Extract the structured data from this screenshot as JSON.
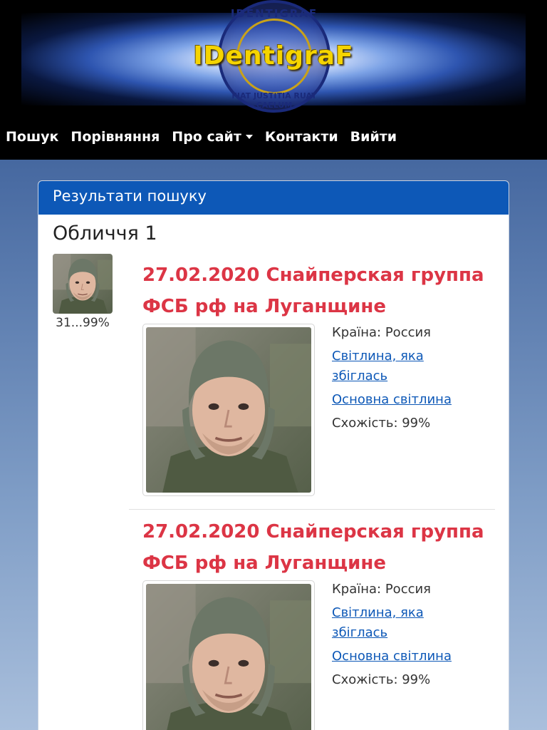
{
  "site": {
    "logo_text": "IDentigraF",
    "emblem_top": "IDENTIGRAF",
    "emblem_bottom": "FIAT JUSTITIA RUAT CAELUM"
  },
  "nav": {
    "items": [
      {
        "label": "Пошук"
      },
      {
        "label": "Порівняння"
      },
      {
        "label": "Про сайт",
        "dropdown": true
      },
      {
        "label": "Контакти"
      },
      {
        "label": "Вийти"
      }
    ]
  },
  "card": {
    "header": "Результати пошуку",
    "faces_title": "Обличчя 1",
    "thumb_caption": "31...99%"
  },
  "results": [
    {
      "title": "27.02.2020 Снайперская группа ФСБ рф на Луганщине",
      "country": "Країна: Россия",
      "matched_photo_link": "Світлина, яка збіглась",
      "main_photo_link": "Основна світлина",
      "similarity": "Схожість: 99%"
    },
    {
      "title": "27.02.2020 Снайперская группа ФСБ рф на Луганщине",
      "country": "Країна: Россия",
      "matched_photo_link": "Світлина, яка збіглась",
      "main_photo_link": "Основна світлина",
      "similarity": "Схожість: 99%"
    }
  ],
  "colors": {
    "header_bg": "#000000",
    "logo": "#f5d400",
    "card_header": "#0d58b7",
    "title_red": "#dc3545",
    "link_blue": "#0d58b7"
  }
}
